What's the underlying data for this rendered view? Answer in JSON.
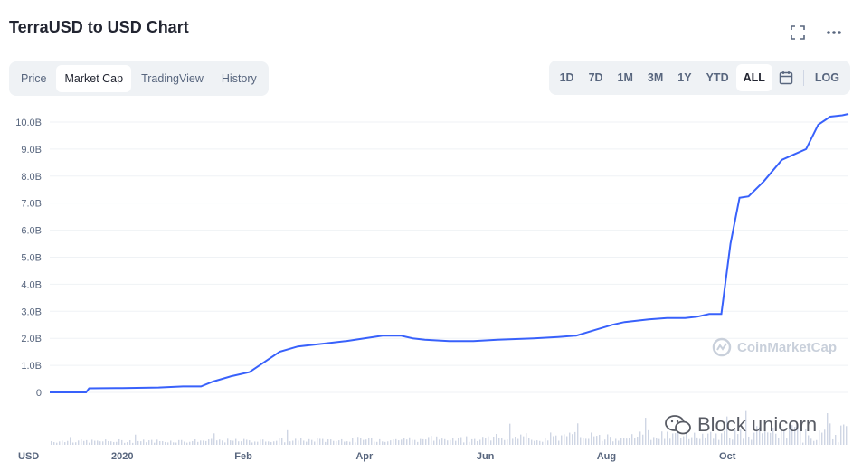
{
  "header": {
    "title": "TerraUSD to USD Chart"
  },
  "tabs": [
    {
      "label": "Price",
      "active": false
    },
    {
      "label": "Market Cap",
      "active": true
    },
    {
      "label": "TradingView",
      "active": false
    },
    {
      "label": "History",
      "active": false
    }
  ],
  "ranges": [
    {
      "label": "1D",
      "active": false
    },
    {
      "label": "7D",
      "active": false
    },
    {
      "label": "1M",
      "active": false
    },
    {
      "label": "3M",
      "active": false
    },
    {
      "label": "1Y",
      "active": false
    },
    {
      "label": "YTD",
      "active": false
    },
    {
      "label": "ALL",
      "active": true
    }
  ],
  "log_label": "LOG",
  "icons": {
    "fullscreen": "fullscreen-icon",
    "more": "more-icon",
    "calendar": "calendar-icon"
  },
  "watermark": {
    "brand": "CoinMarketCap",
    "overlay": "Block unicorn"
  },
  "colors": {
    "line": "#3861fb",
    "grid": "#eff2f5",
    "volume": "#cfd6e4"
  },
  "chart_data": {
    "type": "line",
    "y_unit_label": "USD",
    "ylim": [
      0,
      10.5
    ],
    "yticks": [
      0,
      1,
      2,
      3,
      4,
      5,
      6,
      7,
      8,
      9,
      10
    ],
    "ytick_labels": [
      "0",
      "1.0B",
      "2.0B",
      "3.0B",
      "4.0B",
      "5.0B",
      "6.0B",
      "7.0B",
      "8.0B",
      "9.0B",
      "10.0B"
    ],
    "x_labels": [
      "2020",
      "Feb",
      "Apr",
      "Jun",
      "Aug",
      "Oct"
    ],
    "x_label_pos": [
      0.0,
      2.0,
      4.0,
      6.0,
      8.0,
      10.0
    ],
    "xlim": [
      -1.2,
      10.6
    ],
    "grid": true,
    "series": [
      {
        "values_unit": "billion USD",
        "points": [
          [
            -1.2,
            0.0
          ],
          [
            -0.6,
            0.0
          ],
          [
            -0.55,
            0.15
          ],
          [
            0.0,
            0.16
          ],
          [
            0.6,
            0.18
          ],
          [
            1.0,
            0.22
          ],
          [
            1.3,
            0.22
          ],
          [
            1.5,
            0.4
          ],
          [
            1.8,
            0.6
          ],
          [
            2.1,
            0.75
          ],
          [
            2.4,
            1.2
          ],
          [
            2.6,
            1.5
          ],
          [
            2.9,
            1.7
          ],
          [
            3.3,
            1.8
          ],
          [
            3.7,
            1.9
          ],
          [
            4.0,
            2.0
          ],
          [
            4.3,
            2.1
          ],
          [
            4.6,
            2.1
          ],
          [
            4.8,
            2.0
          ],
          [
            5.0,
            1.95
          ],
          [
            5.4,
            1.9
          ],
          [
            5.8,
            1.9
          ],
          [
            6.2,
            1.95
          ],
          [
            6.8,
            2.0
          ],
          [
            7.2,
            2.05
          ],
          [
            7.5,
            2.1
          ],
          [
            7.8,
            2.3
          ],
          [
            8.1,
            2.5
          ],
          [
            8.3,
            2.6
          ],
          [
            8.7,
            2.7
          ],
          [
            9.0,
            2.75
          ],
          [
            9.3,
            2.75
          ],
          [
            9.5,
            2.8
          ],
          [
            9.7,
            2.9
          ],
          [
            9.9,
            2.9
          ],
          [
            10.05,
            5.5
          ],
          [
            10.2,
            7.2
          ],
          [
            10.35,
            7.25
          ],
          [
            10.6,
            7.8
          ],
          [
            10.9,
            8.6
          ],
          [
            11.1,
            8.8
          ],
          [
            11.3,
            9.0
          ],
          [
            11.5,
            9.9
          ],
          [
            11.7,
            10.2
          ],
          [
            11.9,
            10.25
          ],
          [
            12.0,
            10.3
          ]
        ]
      }
    ]
  }
}
